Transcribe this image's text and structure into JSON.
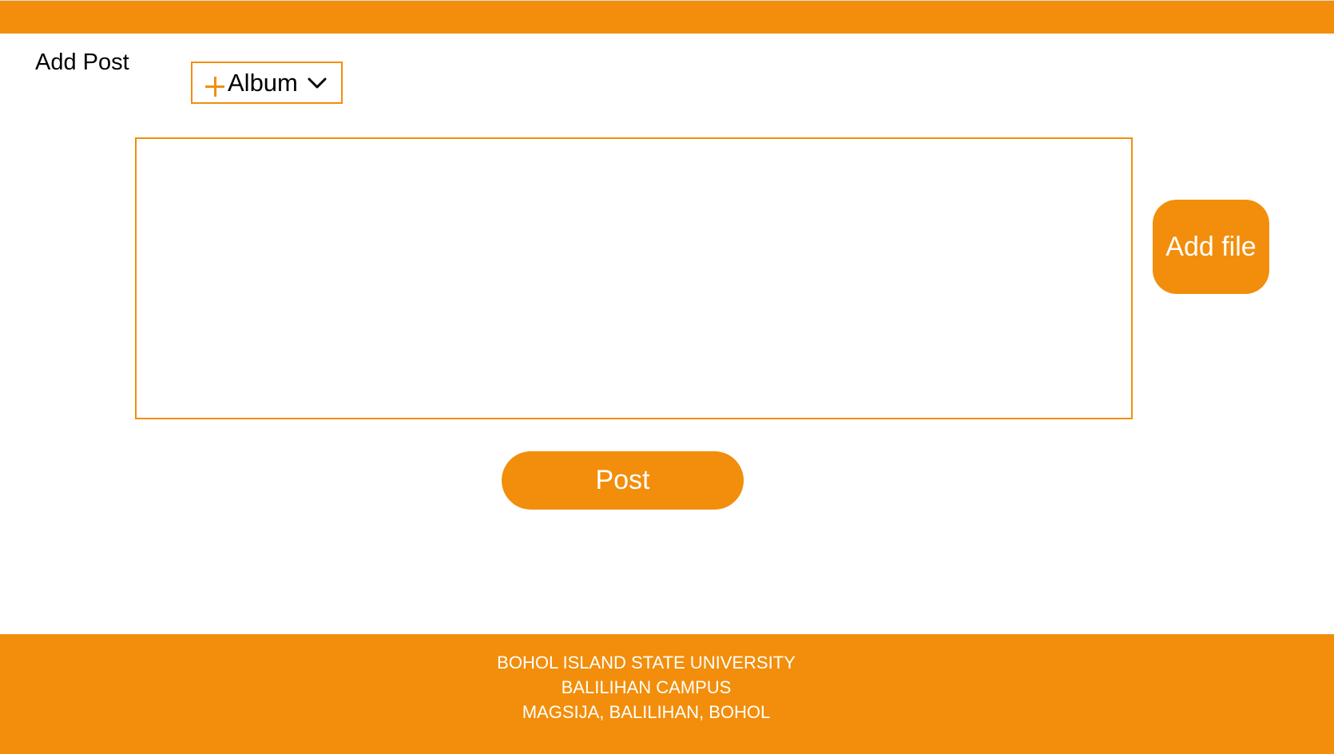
{
  "page": {
    "title": "Add Post"
  },
  "colors": {
    "accent": "#F28E0B",
    "background": "#FFFFFF",
    "text": "#000000"
  },
  "album_button": {
    "label": "Album",
    "icon": "plus-icon",
    "dropdown_icon": "chevron-down-icon"
  },
  "post_textarea": {
    "value": "",
    "placeholder": ""
  },
  "add_file_button": {
    "label": "Add file"
  },
  "post_button": {
    "label": "Post"
  },
  "footer": {
    "lines": [
      "BOHOL ISLAND STATE UNIVERSITY",
      "BALILIHAN CAMPUS",
      "MAGSIJA, BALILIHAN, BOHOL"
    ]
  }
}
